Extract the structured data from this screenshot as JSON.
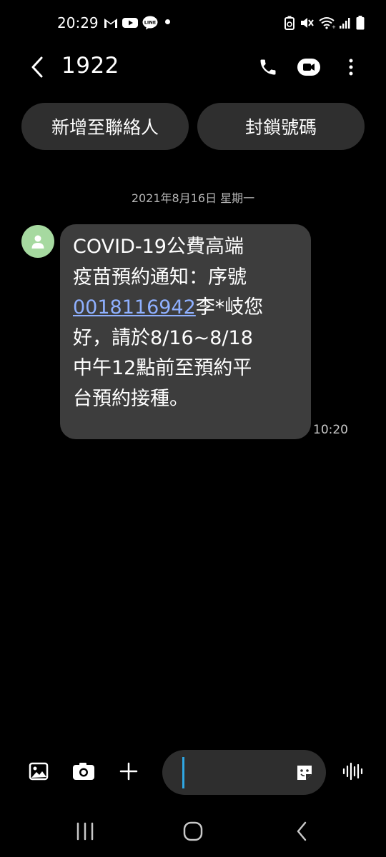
{
  "status_bar": {
    "time": "20:29",
    "left_icons": [
      "gmail-icon",
      "youtube-icon",
      "line-icon"
    ],
    "line_label": "LINE",
    "right_icons": [
      "battery-saver-icon",
      "mute-icon",
      "wifi-icon",
      "signal-icon",
      "battery-icon"
    ]
  },
  "header": {
    "title": "1922",
    "actions": [
      "phone-icon",
      "video-call-icon",
      "more-options-icon"
    ]
  },
  "actions": {
    "add_contact": "新增至聯絡人",
    "block_number": "封鎖號碼"
  },
  "conversation": {
    "date": "2021年8月16日 星期一",
    "message": {
      "line1": "COVID-19公費高端",
      "line2": "疫苗預約通知：序號",
      "link": "0018116942",
      "line3_rest": "李*岐您",
      "line4": "好，請於8/16~8/18",
      "line5": "中午12點前至預約平",
      "line6": "台預約接種。",
      "time": "10:20"
    }
  },
  "composer": {
    "placeholder": "",
    "icons": [
      "gallery-icon",
      "camera-icon",
      "add-icon",
      "sticker-icon",
      "voice-icon"
    ]
  },
  "colors": {
    "background": "#000000",
    "bubble": "#3d3d3d",
    "pill": "#2f2f2f",
    "link": "#8fb0ff",
    "avatar": "#a6d9a0",
    "caret": "#2fa7e3"
  }
}
